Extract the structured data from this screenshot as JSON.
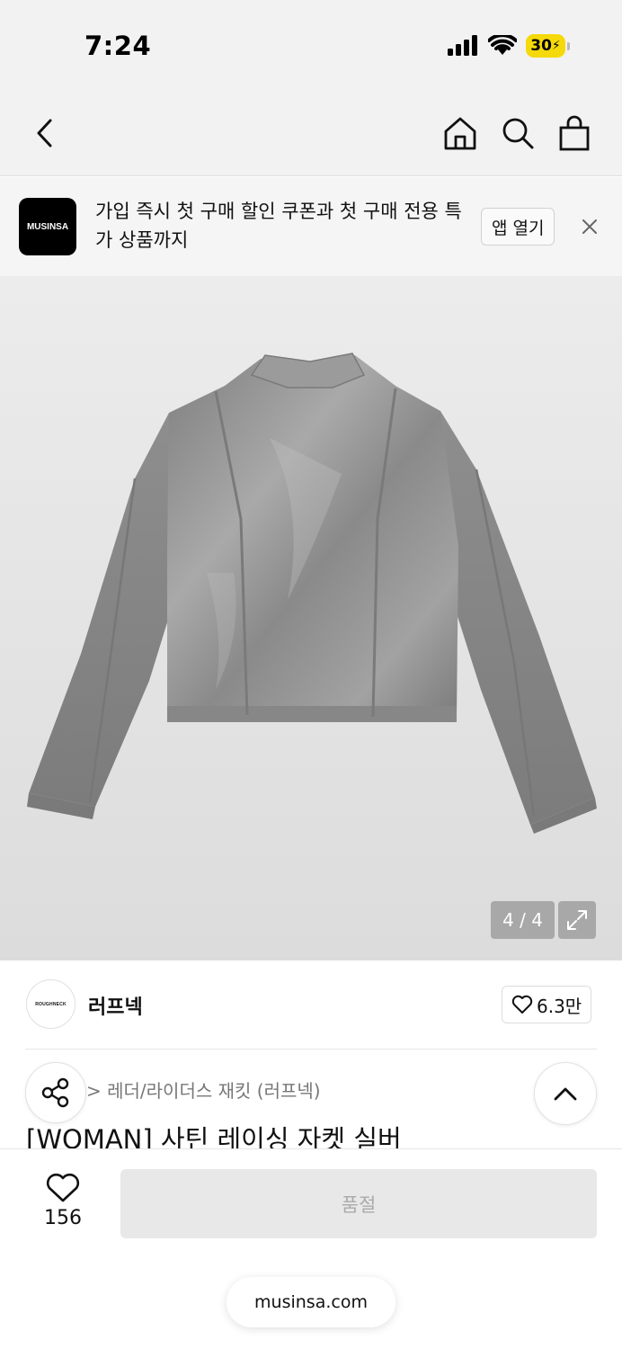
{
  "status_bar": {
    "time": "7:24",
    "battery_level": "30",
    "icons": [
      "signal-icon",
      "wifi-icon",
      "battery-icon"
    ]
  },
  "nav": {
    "icons": [
      "back-icon",
      "home-icon",
      "search-icon",
      "cart-icon"
    ]
  },
  "app_banner": {
    "logo_text": "MUSINSA",
    "message": "가입 즉시 첫 구매 할인 쿠폰과 첫 구매 전용 특가 상품까지",
    "open_label": "앱 열기"
  },
  "gallery": {
    "counter": "4 / 4"
  },
  "brand": {
    "logo_text": "ROUGHNECK",
    "name": "러프넥",
    "likes": "6.3만"
  },
  "product": {
    "breadcrumb": "> 레더/라이더스 재킷 (러프넥)",
    "title": "[WOMAN] 사틴 레이싱 자켓 실버"
  },
  "bottom_bar": {
    "wish_count": "156",
    "soldout_label": "품절"
  },
  "browser": {
    "url": "musinsa.com"
  },
  "colors": {
    "accent_battery": "#f5d90a",
    "jacket": "#8c8c8c"
  }
}
